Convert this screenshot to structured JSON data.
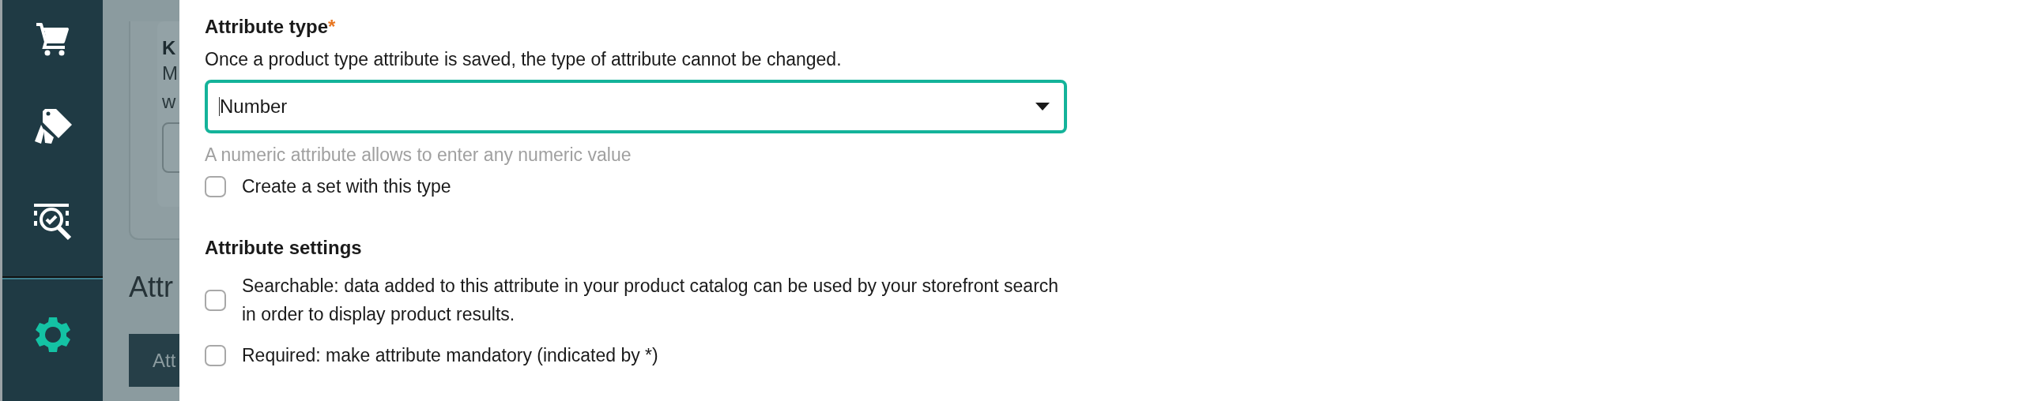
{
  "sidebar": {
    "items": [
      {
        "kind": "cart",
        "selected": false
      },
      {
        "kind": "tags",
        "selected": false
      },
      {
        "kind": "inspect",
        "selected": false
      },
      {
        "kind": "settings",
        "selected": true
      }
    ]
  },
  "background": {
    "card_title": "K",
    "card_lines": [
      "M",
      "w"
    ],
    "heading": "Attr",
    "button": "Att"
  },
  "form": {
    "type_label": "Attribute type",
    "required_mark": "*",
    "type_description": "Once a product type attribute is saved, the type of attribute cannot be changed.",
    "type_select": {
      "value": "Number",
      "focused": true
    },
    "type_hint": "A numeric attribute allows to enter any numeric value",
    "set_option": {
      "label": "Create a set with this type",
      "checked": false
    },
    "settings_title": "Attribute settings",
    "settings": [
      {
        "label": "Searchable: data added to this attribute in your product catalog can be used by your storefront search in order to display product results.",
        "checked": false
      },
      {
        "label": "Required: make attribute mandatory (indicated by *)",
        "checked": false
      }
    ]
  }
}
